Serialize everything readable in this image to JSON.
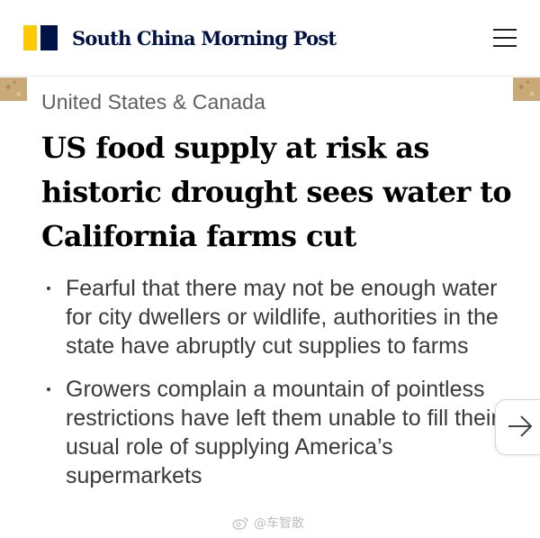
{
  "header": {
    "logo_text": "South China Morning Post",
    "logo_colors": {
      "yellow": "#ffca05",
      "navy": "#001246"
    },
    "menu_icon": "hamburger-menu-icon"
  },
  "article": {
    "section": "United States & Canada",
    "headline": "US food supply at risk as historic drought sees water to California farms cut",
    "bullets": [
      "Fearful that there may not be enough water for city dwellers or wildlife, authorities in the state have abruptly cut supplies to farms",
      "Growers complain a mountain of pointless restrictions have left them unable to fill their usual role of supplying America’s supermarkets"
    ]
  },
  "next_button": {
    "icon": "arrow-right-icon"
  },
  "watermark": {
    "text": "@车智散",
    "icon": "weibo-icon"
  }
}
